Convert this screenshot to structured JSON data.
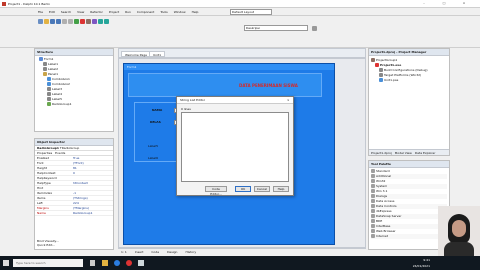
{
  "app": {
    "title": "Project1 - Delphi 10.1 Berlin",
    "menu": [
      "File",
      "Edit",
      "Search",
      "View",
      "Refactor",
      "Project",
      "Run",
      "Component",
      "Tools",
      "Window",
      "Help"
    ],
    "layout": "Default Layout",
    "search_placeholder": "Deskripsi"
  },
  "structure": {
    "title": "Structure",
    "items": [
      "Form1",
      "Label1",
      "Label2",
      "Panel1",
      "Combobox1",
      "Combobox2",
      "Label3",
      "Label4",
      "Label5",
      "RadioGroup1"
    ]
  },
  "inspector": {
    "title": "Object Inspector",
    "object": "RadioGroup1",
    "object_type": "TRadioGroup",
    "tabs": [
      "Properties",
      "Events"
    ],
    "rows": [
      [
        "Enabled",
        "True"
      ],
      [
        "Font",
        "(TFont)"
      ],
      [
        "Height",
        "81"
      ],
      [
        "HelpContext",
        "0"
      ],
      [
        "HelpKeyword",
        ""
      ],
      [
        "HelpType",
        "htContext"
      ],
      [
        "Hint",
        ""
      ],
      [
        "ItemIndex",
        "-1"
      ],
      [
        "Items",
        "(TStrings)"
      ],
      [
        "Left",
        "224"
      ],
      [
        "Margins",
        "(TMargins)"
      ],
      [
        "Name",
        "RadioGroup1"
      ]
    ],
    "footer": [
      "Bind Visually...",
      "Quick Edit..."
    ]
  },
  "designer": {
    "tabs": [
      "Welcome Page",
      "Unit1"
    ],
    "form_caption": "Form1",
    "heading": "DATA PENERIMAAN SISWA",
    "labels": [
      "NAMA",
      "KELAS",
      "Label5",
      "Label6"
    ]
  },
  "dialog": {
    "title": "String List Editor",
    "count_label": "0 lines",
    "buttons": [
      "Code Editor...",
      "OK",
      "Cancel",
      "Help"
    ]
  },
  "project": {
    "title": "Project1.dproj - Project Manager",
    "items": [
      "ProjectGroup1",
      "Project1.exe",
      "Build Configurations (Debug)",
      "Target Platforms (Win32)",
      "Unit1.pas"
    ],
    "tabs": [
      "Project1.dproj",
      "Model View",
      "Data Explorer"
    ]
  },
  "palette": {
    "title": "Tool Palette",
    "items": [
      "Standard",
      "Additional",
      "Win32",
      "System",
      "Win 3.1",
      "Dialogs",
      "Data Access",
      "Data Controls",
      "dbExpress",
      "DataSnap Server",
      "BDE",
      "InterBase",
      "Web Browser",
      "Internet"
    ]
  },
  "status": {
    "left": "1: 1",
    "mode": "Insert",
    "tabs": [
      "Code",
      "Design",
      "History"
    ]
  },
  "taskbar": {
    "search_placeholder": "Type here to search",
    "time": "9:41",
    "date": "24/01/2021"
  },
  "colors": {
    "form_blue": "#1e7be8",
    "panel_blue": "#2e8ef0",
    "heading_red": "#d42a2a",
    "taskbar": "#101820"
  }
}
